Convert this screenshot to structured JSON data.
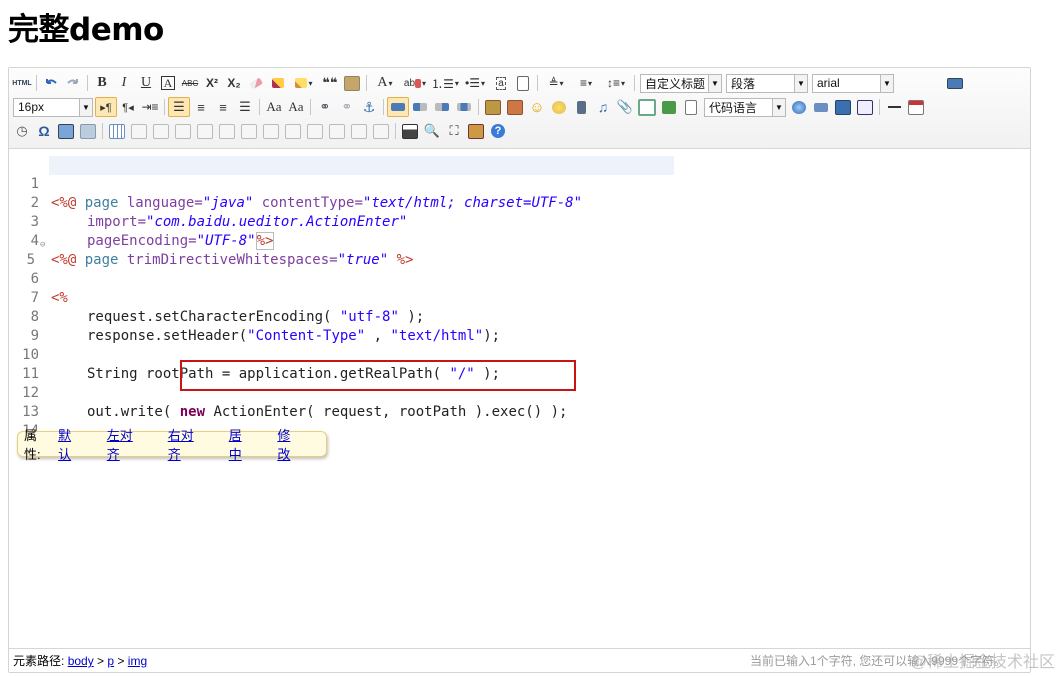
{
  "page": {
    "title": "完整demo"
  },
  "toolbar": {
    "combos": {
      "custom_title": "自定义标题",
      "paragraph": "段落",
      "font": "arial",
      "font_size": "16px",
      "code_lang": "代码语言"
    },
    "labels": {
      "html": "HTML",
      "bold": "B",
      "italic": "I",
      "underline": "U",
      "strike": "ABC",
      "sup": "X²",
      "sub": "X₂",
      "omega": "Ω",
      "font_color": "A",
      "quote": "66"
    }
  },
  "code": {
    "lines": [
      {
        "n": "1"
      },
      {
        "n": "2"
      },
      {
        "n": "3"
      },
      {
        "n": "4"
      },
      {
        "n": "5"
      },
      {
        "n": "6"
      },
      {
        "n": "7"
      },
      {
        "n": "8"
      },
      {
        "n": "9"
      },
      {
        "n": "10"
      },
      {
        "n": "11"
      },
      {
        "n": "12"
      },
      {
        "n": "13"
      },
      {
        "n": "14"
      }
    ],
    "t1": [
      "<%@ ",
      "page ",
      "language=",
      "\"java\"",
      " contentType=",
      "\"text/html; charset=UTF-8\""
    ],
    "t2": [
      "import=",
      "\"com.baidu.ueditor.ActionEnter\""
    ],
    "t3": [
      "pageEncoding=",
      "\"UTF-8\"",
      "%>"
    ],
    "t4": [
      "<%@ ",
      "page ",
      "trimDirectiveWhitespaces=",
      "\"true\"",
      " %>"
    ],
    "t5": "<%",
    "t7": [
      "request.setCharacterEncoding( ",
      "\"utf-8\"",
      " );"
    ],
    "t8": [
      "response.setHeader(",
      "\"Content-Type\"",
      " , ",
      "\"text/html\"",
      ");"
    ],
    "t10": [
      "String rootPath = application.getRealPath( ",
      "\"/\"",
      " );"
    ],
    "t12": [
      "out.write( ",
      "new",
      " ActionEnter( request, rootPath ).exec() );"
    ],
    "t14": "%>"
  },
  "popup": {
    "label": "属性:",
    "links": [
      "默认",
      "左对齐",
      "右对齐",
      "居中",
      "修改"
    ]
  },
  "status": {
    "prefix": "元素路径:",
    "path": [
      "body",
      "p",
      "img"
    ],
    "sep": " > ",
    "count": "当前已输入1个字符, 您还可以输入9999个字符。",
    "watermark": "@稀土掘金技术社区"
  },
  "colors": {
    "highlight_box": "#c81414",
    "popup_bg": "#fffbe0"
  }
}
